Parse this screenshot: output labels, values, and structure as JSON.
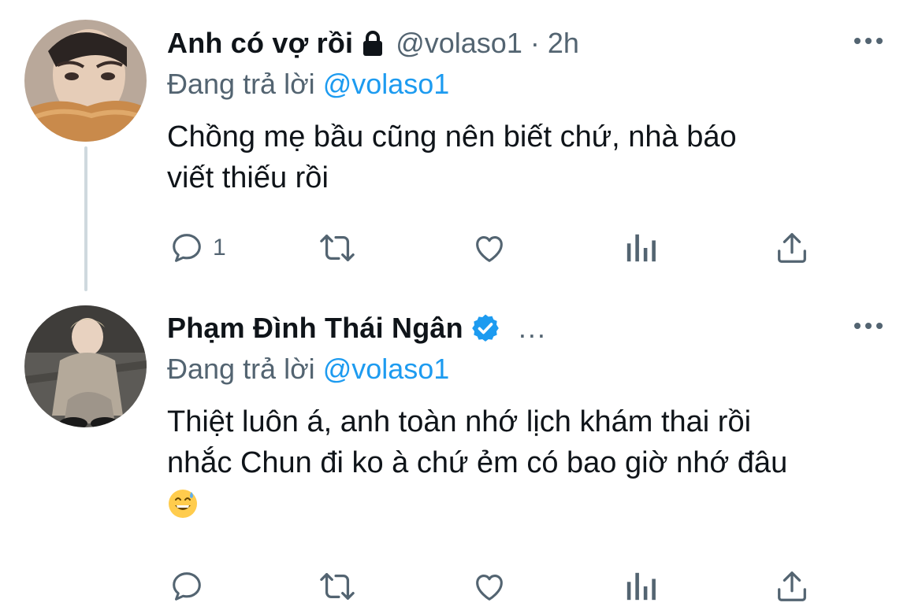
{
  "tweets": [
    {
      "display_name": "Anh có vợ rồi",
      "handle": "@volaso1",
      "separator": "·",
      "time": "2h",
      "protected": true,
      "reply_prefix": "Đang trả lời",
      "reply_mention": "@volaso1",
      "text_lines": [
        "Chồng mẹ bầu cũng nên biết chứ, nhà báo",
        "viết thiếu rồi"
      ],
      "actions": {
        "reply_count": "1",
        "retweet_count": "",
        "like_count": ""
      }
    },
    {
      "display_name": "Phạm Đình Thái Ngân",
      "verified": true,
      "truncated_meta": "...",
      "reply_prefix": "Đang trả lời",
      "reply_mention": "@volaso1",
      "text_lines": [
        "Thiệt luôn á, anh toàn nhớ lịch khám thai rồi",
        "nhắc Chun đi ko à chứ ẻm có bao giờ nhớ đâu"
      ],
      "emoji": "grinning-face-with-sweat",
      "actions": {
        "reply_count": "",
        "retweet_count": "",
        "like_count": ""
      }
    }
  ],
  "colors": {
    "link": "#1d9bf0",
    "secondary_text": "#536471",
    "thread_line": "#cfd9de",
    "verified": "#1d9bf0"
  },
  "icons": [
    "lock-icon",
    "verified-badge-icon",
    "more-options-icon",
    "reply-icon",
    "retweet-icon",
    "like-icon",
    "analytics-icon",
    "share-icon"
  ]
}
